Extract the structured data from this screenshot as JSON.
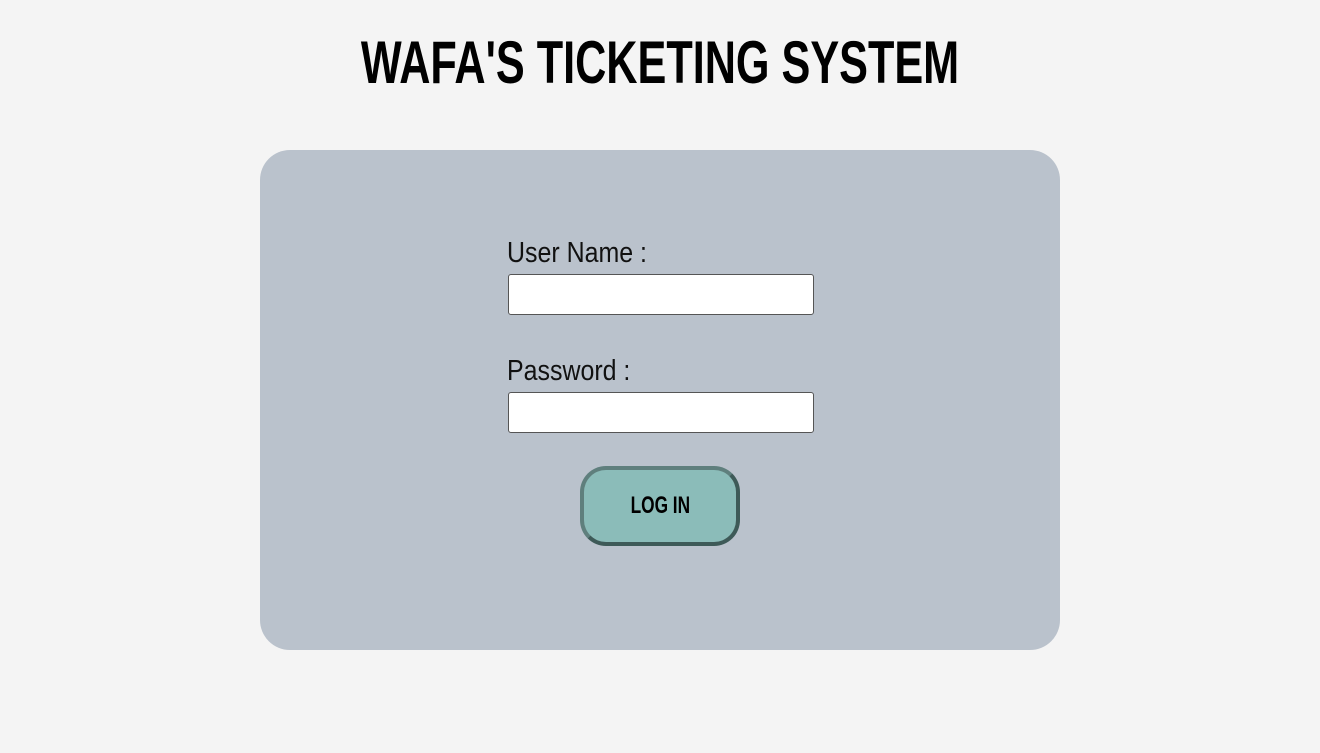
{
  "header": {
    "title": "WAFA'S TICKETING SYSTEM"
  },
  "login_form": {
    "username_label": "User Name :",
    "username_value": "",
    "password_label": "Password :",
    "password_value": "",
    "submit_label": "LOG IN"
  },
  "colors": {
    "page_background": "#f4f4f4",
    "card_background": "#bac2cc",
    "button_background": "#8bbcb9",
    "button_border": "#3e5a58"
  }
}
